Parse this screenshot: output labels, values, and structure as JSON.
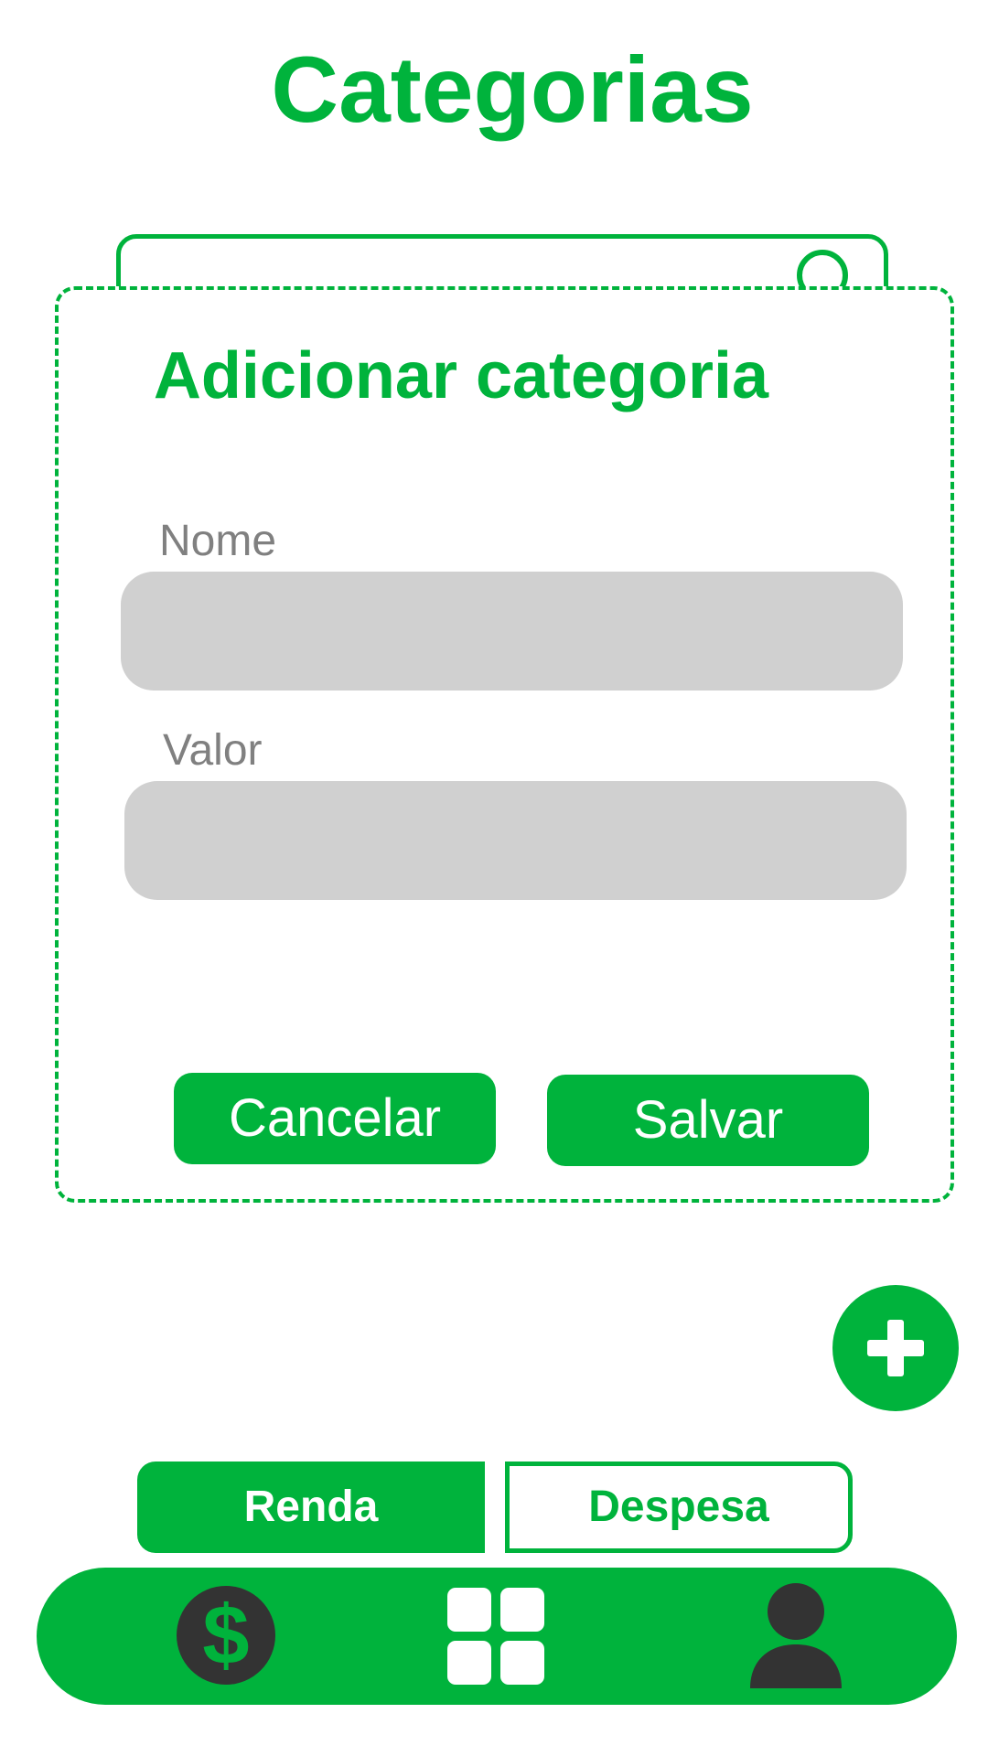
{
  "header": {
    "title": "Categorias"
  },
  "dialog": {
    "title": "Adicionar categoria",
    "name_label": "Nome",
    "name_value": "",
    "value_label": "Valor",
    "value_value": "",
    "cancel_label": "Cancelar",
    "save_label": "Salvar"
  },
  "fab": {
    "icon": "plus-icon"
  },
  "toggle": {
    "income_label": "Renda",
    "expense_label": "Despesa",
    "selected": "Renda"
  },
  "bottom_nav": {
    "items": [
      {
        "icon": "dollar-icon"
      },
      {
        "icon": "grid-icon"
      },
      {
        "icon": "user-icon"
      }
    ]
  },
  "colors": {
    "accent": "#00b33c",
    "input_bg": "#d0d0d0",
    "label": "#808080",
    "icon_dark": "#333333"
  }
}
